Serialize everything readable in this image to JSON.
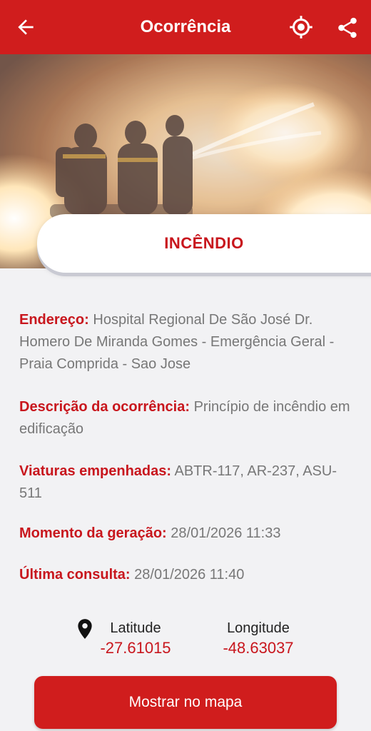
{
  "appbar": {
    "title": "Ocorrência",
    "back_icon": "arrow-back-icon",
    "location_icon": "gps-target-icon",
    "share_icon": "share-icon",
    "color": "#d01d1d"
  },
  "hero": {
    "image": "firefighters-spraying-water-on-fire"
  },
  "incident": {
    "type": "INCÊNDIO"
  },
  "details": {
    "endereco_label": "Endereço:",
    "endereco_value": "Hospital Regional De São José Dr. Homero De Miranda Gomes - Emergência Geral - Praia Comprida - Sao Jose",
    "descricao_label": "Descrição da ocorrência:",
    "descricao_value": "Princípio de incêndio em edificação",
    "viaturas_label": "Viaturas empenhadas:",
    "viaturas_value": "ABTR-117, AR-237, ASU-511",
    "momento_label": "Momento da geração:",
    "momento_value": "28/01/2026 11:33",
    "ultima_label": "Última consulta:",
    "ultima_value": "28/01/2026 11:40"
  },
  "coordinates": {
    "pin_icon": "location-pin-icon",
    "latitude_label": "Latitude",
    "latitude_value": "-27.61015",
    "longitude_label": "Longitude",
    "longitude_value": "-48.63037"
  },
  "actions": {
    "show_map_label": "Mostrar no mapa"
  }
}
